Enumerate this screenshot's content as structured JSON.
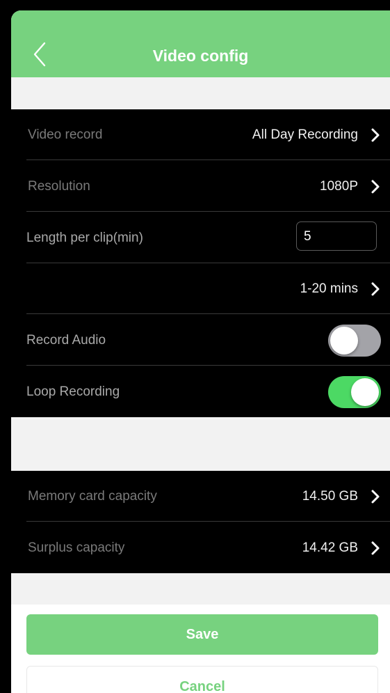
{
  "header": {
    "title": "Video config",
    "back_icon": "chevron-left-icon",
    "background_color": "#77d27f"
  },
  "recording": {
    "video_record": {
      "label": "Video record",
      "value": "All Day Recording"
    },
    "resolution": {
      "label": "Resolution",
      "value": "1080P"
    },
    "clip_length": {
      "label": "Length per clip(min)",
      "value": "5"
    },
    "clip_range": {
      "value": "1-20 mins"
    },
    "record_audio": {
      "label": "Record Audio",
      "enabled": false
    },
    "loop_recording": {
      "label": "Loop Recording",
      "enabled": true
    }
  },
  "storage": {
    "memory_card": {
      "label": "Memory card capacity",
      "value": "14.50 GB"
    },
    "surplus": {
      "label": "Surplus capacity",
      "value": "14.42 GB"
    }
  },
  "actions": {
    "save_label": "Save",
    "cancel_label": "Cancel"
  },
  "colors": {
    "accent": "#77d27f",
    "toggle_on": "#4cd964",
    "toggle_off": "#a3a3a8"
  }
}
